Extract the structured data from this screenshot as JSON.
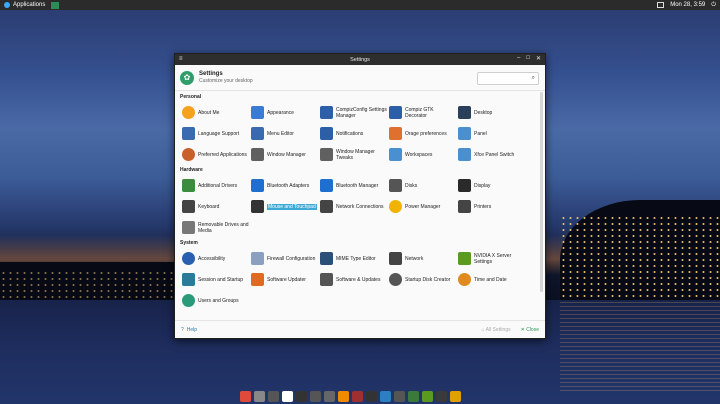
{
  "top_panel": {
    "apps_label": "Applications",
    "clock": "Mon 28, 3:59"
  },
  "window": {
    "title": "Settings",
    "menu_icon": "≡",
    "header_title": "Settings",
    "header_subtitle": "Customize your desktop",
    "search_placeholder": ""
  },
  "sections": {
    "personal": {
      "label": "Personal",
      "items": [
        {
          "label": "About Me",
          "icon": "person-icon",
          "color": "#f4a21e"
        },
        {
          "label": "Appearance",
          "icon": "appearance-icon",
          "color": "#3a7bd5"
        },
        {
          "label": "CompizConfig Settings Manager",
          "icon": "compiz-icon",
          "color": "#2c5fa8"
        },
        {
          "label": "Compiz GTK Decorator",
          "icon": "compiz-gtk-icon",
          "color": "#2c5fa8"
        },
        {
          "label": "Desktop",
          "icon": "desktop-icon",
          "color": "#2a3f5a"
        },
        {
          "label": "Language Support",
          "icon": "language-icon",
          "color": "#3a6ab0"
        },
        {
          "label": "Menu Editor",
          "icon": "menu-editor-icon",
          "color": "#3a6ab0"
        },
        {
          "label": "Notifications",
          "icon": "notifications-icon",
          "color": "#2c5fa8"
        },
        {
          "label": "Orage preferences",
          "icon": "orage-icon",
          "color": "#e07030"
        },
        {
          "label": "Panel",
          "icon": "panel-icon",
          "color": "#4a90d0"
        },
        {
          "label": "Preferred Applications",
          "icon": "star-icon",
          "color": "#c9602a"
        },
        {
          "label": "Window Manager",
          "icon": "window-manager-icon",
          "color": "#606060"
        },
        {
          "label": "Window Manager Tweaks",
          "icon": "wm-tweaks-icon",
          "color": "#606060"
        },
        {
          "label": "Workspaces",
          "icon": "workspaces-icon",
          "color": "#4a90d0"
        },
        {
          "label": "Xfce Panel Switch",
          "icon": "panel-switch-icon",
          "color": "#4a90d0"
        }
      ]
    },
    "hardware": {
      "label": "Hardware",
      "items": [
        {
          "label": "Additional Drivers",
          "icon": "drivers-icon",
          "color": "#3d8b3d"
        },
        {
          "label": "Bluetooth Adapters",
          "icon": "bluetooth-icon",
          "color": "#1f6fd0"
        },
        {
          "label": "Bluetooth Manager",
          "icon": "bluetooth-icon",
          "color": "#1f6fd0"
        },
        {
          "label": "Disks",
          "icon": "disks-icon",
          "color": "#555555"
        },
        {
          "label": "Display",
          "icon": "display-icon",
          "color": "#2a2a2a"
        },
        {
          "label": "Keyboard",
          "icon": "keyboard-icon",
          "color": "#444444"
        },
        {
          "label": "Mouse and Touchpad",
          "icon": "mouse-icon",
          "color": "#333333",
          "selected": true
        },
        {
          "label": "Network Connections",
          "icon": "network-connections-icon",
          "color": "#444444"
        },
        {
          "label": "Power Manager",
          "icon": "power-icon",
          "color": "#f0b400"
        },
        {
          "label": "Printers",
          "icon": "printer-icon",
          "color": "#444444"
        },
        {
          "label": "Removable Drives and Media",
          "icon": "removable-drive-icon",
          "color": "#777777"
        }
      ]
    },
    "system": {
      "label": "System",
      "items": [
        {
          "label": "Accessibility",
          "icon": "accessibility-icon",
          "color": "#2a5fb0"
        },
        {
          "label": "Firewall Configuration",
          "icon": "firewall-icon",
          "color": "#8aa0c0"
        },
        {
          "label": "MIME Type Editor",
          "icon": "gear-icon",
          "color": "#2c4f7a"
        },
        {
          "label": "Network",
          "icon": "network-icon",
          "color": "#444444"
        },
        {
          "label": "NVIDIA X Server Settings",
          "icon": "nvidia-icon",
          "color": "#5a9a20"
        },
        {
          "label": "Session and Startup",
          "icon": "session-icon",
          "color": "#2a7a9a"
        },
        {
          "label": "Software Updater",
          "icon": "updater-icon",
          "color": "#e06a20"
        },
        {
          "label": "Software & Updates",
          "icon": "software-updates-icon",
          "color": "#555555"
        },
        {
          "label": "Startup Disk Creator",
          "icon": "startup-disk-icon",
          "color": "#555555"
        },
        {
          "label": "Time and Date",
          "icon": "clock-icon",
          "color": "#e08a20"
        },
        {
          "label": "Users and Groups",
          "icon": "users-icon",
          "color": "#2a9a7a"
        }
      ]
    }
  },
  "footer": {
    "help": "Help",
    "all_settings": "All Settings",
    "close": "Close"
  },
  "dock": [
    {
      "icon": "chrome-icon",
      "color": "#e04a3a"
    },
    {
      "icon": "files-icon",
      "color": "#888888"
    },
    {
      "icon": "calculator-icon",
      "color": "#555555"
    },
    {
      "icon": "cards-icon",
      "color": "#ffffff"
    },
    {
      "icon": "terminal-icon",
      "color": "#333333"
    },
    {
      "icon": "media-icon",
      "color": "#555555"
    },
    {
      "icon": "settings-icon",
      "color": "#666666"
    },
    {
      "icon": "vlc-icon",
      "color": "#f08a00"
    },
    {
      "icon": "ftp-icon",
      "color": "#a03030"
    },
    {
      "icon": "amazon-icon",
      "color": "#333333"
    },
    {
      "icon": "search-icon",
      "color": "#2a80c0"
    },
    {
      "icon": "disk-icon",
      "color": "#555555"
    },
    {
      "icon": "mail-icon",
      "color": "#3a7a3a"
    },
    {
      "icon": "nvidia-icon",
      "color": "#5a9a20"
    },
    {
      "icon": "app-icon",
      "color": "#3a3a3a"
    },
    {
      "icon": "pc-icon",
      "color": "#e0a000"
    }
  ]
}
